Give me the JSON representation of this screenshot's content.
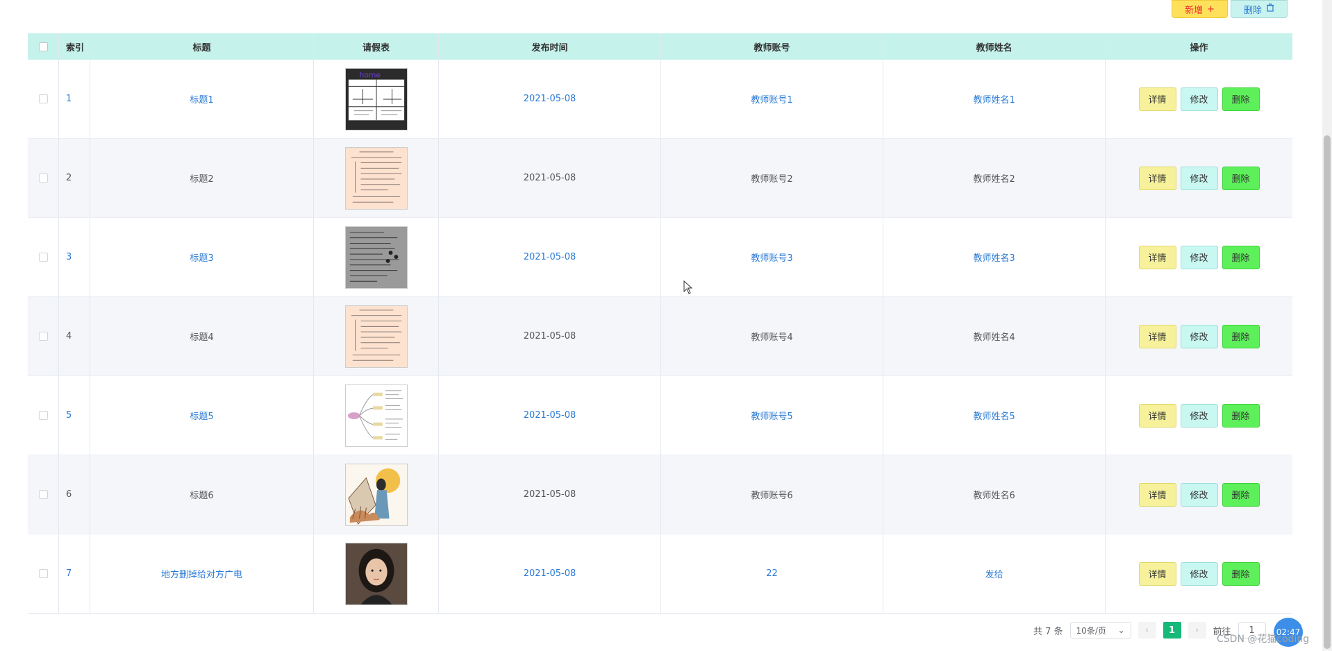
{
  "toolbar": {
    "add_label": "新增",
    "add_icon": "plus-icon",
    "delete_label": "删除",
    "delete_icon": "trash-icon"
  },
  "table": {
    "headers": [
      "索引",
      "标题",
      "请假表",
      "发布时间",
      "教师账号",
      "教师姓名",
      "操作"
    ],
    "rows": [
      {
        "index": "1",
        "title": "标题1",
        "time": "2021-05-08",
        "account": "教师账号1",
        "name": "教师姓名1"
      },
      {
        "index": "2",
        "title": "标题2",
        "time": "2021-05-08",
        "account": "教师账号2",
        "name": "教师姓名2"
      },
      {
        "index": "3",
        "title": "标题3",
        "time": "2021-05-08",
        "account": "教师账号3",
        "name": "教师姓名3"
      },
      {
        "index": "4",
        "title": "标题4",
        "time": "2021-05-08",
        "account": "教师账号4",
        "name": "教师姓名4"
      },
      {
        "index": "5",
        "title": "标题5",
        "time": "2021-05-08",
        "account": "教师账号5",
        "name": "教师姓名5"
      },
      {
        "index": "6",
        "title": "标题6",
        "time": "2021-05-08",
        "account": "教师账号6",
        "name": "教师姓名6"
      },
      {
        "index": "7",
        "title": "地方删掉给对方广电",
        "time": "2021-05-08",
        "account": "22",
        "name": "发给"
      }
    ],
    "actions": {
      "detail": "详情",
      "edit": "修改",
      "delete": "删除"
    }
  },
  "pagination": {
    "total_label": "共 7 条",
    "page_size": "10条/页",
    "current_page": "1",
    "goto_label": "前往",
    "goto_value": "1"
  },
  "overlay": {
    "fab_text": "02:47",
    "watermark": "CSDN @花猫coding"
  }
}
